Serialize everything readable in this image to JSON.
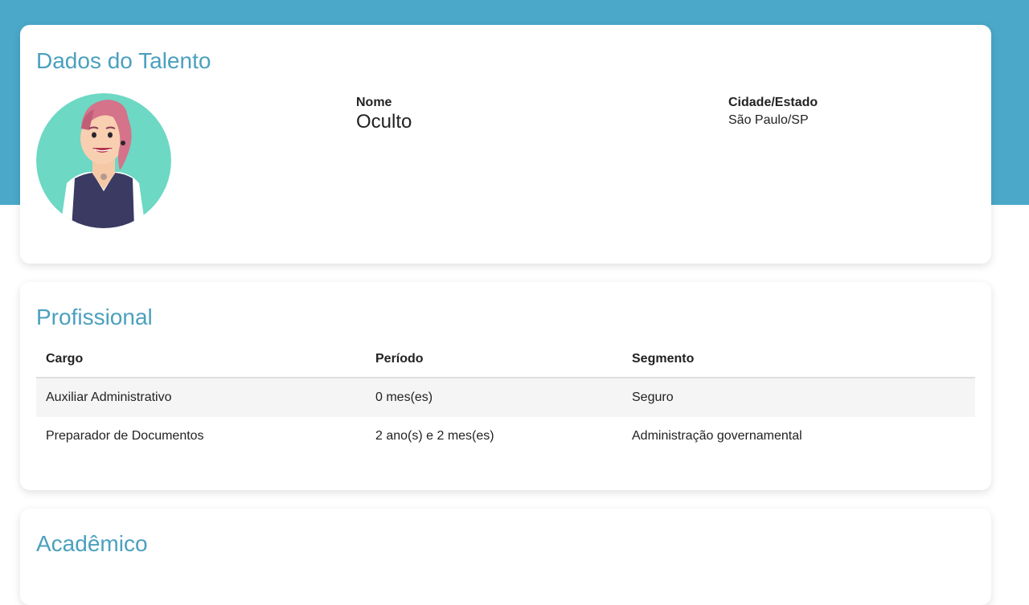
{
  "talent": {
    "title": "Dados do Talento",
    "name_label": "Nome",
    "name_value": "Oculto",
    "city_label": "Cidade/Estado",
    "city_value": "São Paulo/SP",
    "avatar_icon": "person-avatar-illustration"
  },
  "professional": {
    "title": "Profissional",
    "columns": [
      "Cargo",
      "Período",
      "Segmento"
    ],
    "rows": [
      [
        "Auxiliar Administrativo",
        "0 mes(es)",
        "Seguro"
      ],
      [
        "Preparador de Documentos",
        "2 ano(s) e 2 mes(es)",
        "Administração governamental"
      ]
    ]
  },
  "academic": {
    "title": "Acadêmico"
  },
  "colors": {
    "accent": "#4ba8c9",
    "title": "#4ba0be",
    "avatar_bg": "#6dd8c3",
    "hair": "#d4738a",
    "vest": "#3b3a63"
  }
}
